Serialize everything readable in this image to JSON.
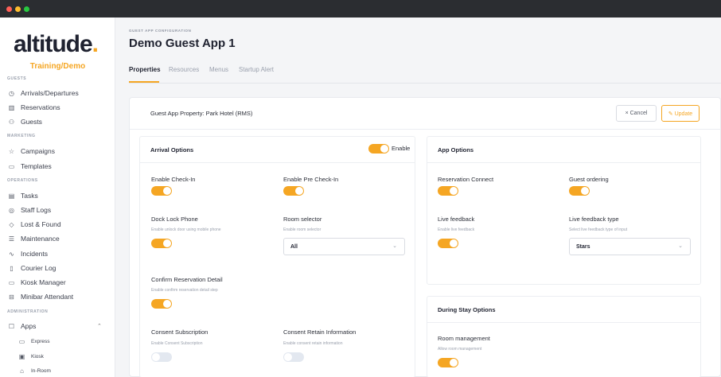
{
  "window": {
    "controls": [
      "close",
      "minimize",
      "zoom"
    ]
  },
  "sidebar": {
    "logo": "altitude",
    "logo_dot": ".",
    "environment": "Training/Demo",
    "sections": {
      "guests": "GUESTS",
      "marketing": "MARKETING",
      "operations": "OPERATIONS",
      "administration": "ADMINISTRATION"
    },
    "items": {
      "arrivals": {
        "label": "Arrivals/Departures",
        "icon": "clock-icon"
      },
      "reservations": {
        "label": "Reservations",
        "icon": "building-icon"
      },
      "guests": {
        "label": "Guests",
        "icon": "users-icon"
      },
      "campaigns": {
        "label": "Campaigns",
        "icon": "star-icon"
      },
      "templates": {
        "label": "Templates",
        "icon": "folder-icon"
      },
      "tasks": {
        "label": "Tasks",
        "icon": "tasks-icon"
      },
      "staff_logs": {
        "label": "Staff Logs",
        "icon": "logs-icon"
      },
      "lost_found": {
        "label": "Lost & Found",
        "icon": "tag-icon"
      },
      "maintenance": {
        "label": "Maintenance",
        "icon": "server-icon"
      },
      "incidents": {
        "label": "Incidents",
        "icon": "pulse-icon"
      },
      "courier_log": {
        "label": "Courier Log",
        "icon": "tablet-icon"
      },
      "kiosk_manager": {
        "label": "Kiosk Manager",
        "icon": "monitor-icon"
      },
      "minibar": {
        "label": "Minibar Attendant",
        "icon": "fridge-icon"
      },
      "apps": {
        "label": "Apps",
        "icon": "square-icon"
      },
      "express": {
        "label": "Express",
        "icon": "card-icon"
      },
      "kiosk": {
        "label": "Kiosk",
        "icon": "calendar-icon"
      },
      "in_room": {
        "label": "In-Room",
        "icon": "home-icon"
      }
    }
  },
  "header": {
    "eyebrow": "GUEST APP CONFIGURATION",
    "title": "Demo Guest App 1",
    "tabs": [
      "Properties",
      "Resources",
      "Menus",
      "Startup Alert"
    ],
    "active_tab": "Properties"
  },
  "panel": {
    "property_label": "Guest App Property: Park Hotel (RMS)",
    "cancel_label": "× Cancel",
    "update_label": "✎ Update"
  },
  "arrival": {
    "title": "Arrival Options",
    "enable_label": "Enable",
    "enabled": true,
    "check_in": {
      "label": "Enable Check-In",
      "on": true
    },
    "pre_check_in": {
      "label": "Enable Pre Check-In",
      "on": true
    },
    "dock_lock": {
      "label": "Dock Lock Phone",
      "help": "Enable unlock door using mobile phone",
      "on": true
    },
    "room_selector": {
      "label": "Room selector",
      "help": "Enable room selector",
      "value": "All"
    },
    "confirm": {
      "label": "Confirm Reservation Detail",
      "help": "Enable confirm reservation detail step",
      "on": true
    },
    "consent_sub": {
      "label": "Consent Subscription",
      "help": "Enable Consent Subscription",
      "on": false
    },
    "consent_retain": {
      "label": "Consent Retain Information",
      "help": "Enable consent retain information",
      "on": false
    }
  },
  "app_options": {
    "title": "App Options",
    "reservation_connect": {
      "label": "Reservation Connect",
      "on": true
    },
    "guest_ordering": {
      "label": "Guest ordering",
      "on": true
    },
    "live_feedback": {
      "label": "Live feedback",
      "help": "Enable live feedback",
      "on": true
    },
    "live_feedback_type": {
      "label": "Live feedback type",
      "help": "Select live feedback type of input",
      "value": "Stars"
    }
  },
  "stay_options": {
    "title": "During Stay Options",
    "room_management": {
      "label": "Room management",
      "help": "Allow room management",
      "on": true
    }
  },
  "colors": {
    "accent": "#f5a623",
    "toggle_off": "#e3e8f0",
    "text": "#1f2230",
    "muted": "#9aa0ad"
  }
}
